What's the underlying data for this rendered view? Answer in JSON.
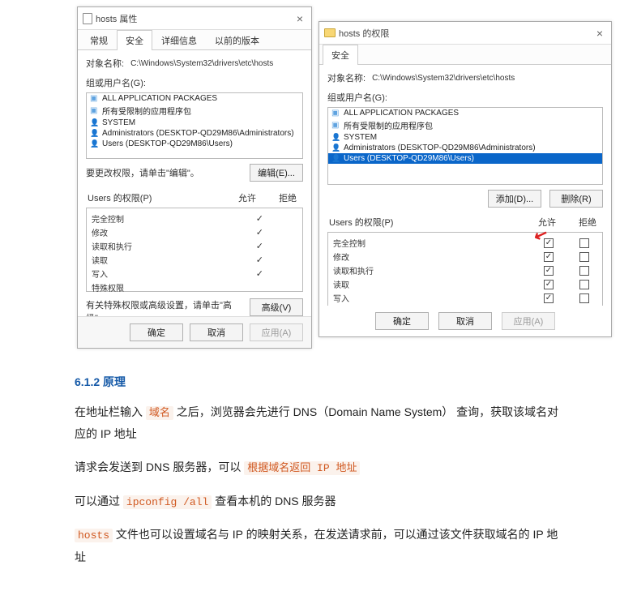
{
  "dialog_left": {
    "title": "hosts 属性",
    "tabs": [
      "常规",
      "安全",
      "详细信息",
      "以前的版本"
    ],
    "active_tab_index": 1,
    "object_name_label": "对象名称:",
    "object_name_value": "C:\\Windows\\System32\\drivers\\etc\\hosts",
    "group_label": "组或用户名(G):",
    "groups": [
      {
        "icon": "pkg",
        "text": "ALL APPLICATION PACKAGES"
      },
      {
        "icon": "pkg",
        "text": "所有受限制的应用程序包"
      },
      {
        "icon": "user",
        "text": "SYSTEM"
      },
      {
        "icon": "user",
        "text": "Administrators (DESKTOP-QD29M86\\Administrators)"
      },
      {
        "icon": "user",
        "text": "Users (DESKTOP-QD29M86\\Users)"
      }
    ],
    "edit_hint": "要更改权限，请单击\"编辑\"。",
    "edit_button": "编辑(E)...",
    "perm_header": "Users 的权限(P)",
    "allow_header": "允许",
    "deny_header": "拒绝",
    "permissions": [
      {
        "name": "完全控制",
        "allow": true,
        "deny": false
      },
      {
        "name": "修改",
        "allow": true,
        "deny": false
      },
      {
        "name": "读取和执行",
        "allow": true,
        "deny": false
      },
      {
        "name": "读取",
        "allow": true,
        "deny": false
      },
      {
        "name": "写入",
        "allow": true,
        "deny": false
      },
      {
        "name": "特殊权限",
        "allow": false,
        "deny": false
      }
    ],
    "advanced_hint": "有关特殊权限或高级设置，请单击\"高级\"。",
    "advanced_button": "高级(V)",
    "ok": "确定",
    "cancel": "取消",
    "apply": "应用(A)"
  },
  "dialog_right": {
    "title": "hosts 的权限",
    "tab": "安全",
    "object_name_label": "对象名称:",
    "object_name_value": "C:\\Windows\\System32\\drivers\\etc\\hosts",
    "group_label": "组或用户名(G):",
    "groups": [
      {
        "icon": "pkg",
        "text": "ALL APPLICATION PACKAGES",
        "selected": false
      },
      {
        "icon": "pkg",
        "text": "所有受限制的应用程序包",
        "selected": false
      },
      {
        "icon": "user",
        "text": "SYSTEM",
        "selected": false
      },
      {
        "icon": "user",
        "text": "Administrators (DESKTOP-QD29M86\\Administrators)",
        "selected": false
      },
      {
        "icon": "user",
        "text": "Users (DESKTOP-QD29M86\\Users)",
        "selected": true
      }
    ],
    "add_button": "添加(D)...",
    "remove_button": "删除(R)",
    "perm_header": "Users 的权限(P)",
    "allow_header": "允许",
    "deny_header": "拒绝",
    "permissions": [
      {
        "name": "完全控制",
        "allow": true,
        "deny": false
      },
      {
        "name": "修改",
        "allow": true,
        "deny": false
      },
      {
        "name": "读取和执行",
        "allow": true,
        "deny": false
      },
      {
        "name": "读取",
        "allow": true,
        "deny": false
      },
      {
        "name": "写入",
        "allow": true,
        "deny": false
      }
    ],
    "ok": "确定",
    "cancel": "取消",
    "apply": "应用(A)"
  },
  "article": {
    "heading": "6.1.2 原理",
    "p1_a": "在地址栏输入 ",
    "p1_code": "域名",
    "p1_b": " 之后，浏览器会先进行 DNS（Domain Name System） 查询，获取该域名对应的 IP 地址",
    "p2_a": "请求会发送到 DNS 服务器，可以 ",
    "p2_code": "根据域名返回 IP 地址",
    "p3_a": "可以通过 ",
    "p3_code": "ipconfig /all",
    "p3_b": " 查看本机的 DNS 服务器",
    "p4_code": "hosts",
    "p4_a": " 文件也可以设置域名与 IP 的映射关系，在发送请求前，可以通过该文件获取域名的 IP 地址"
  }
}
